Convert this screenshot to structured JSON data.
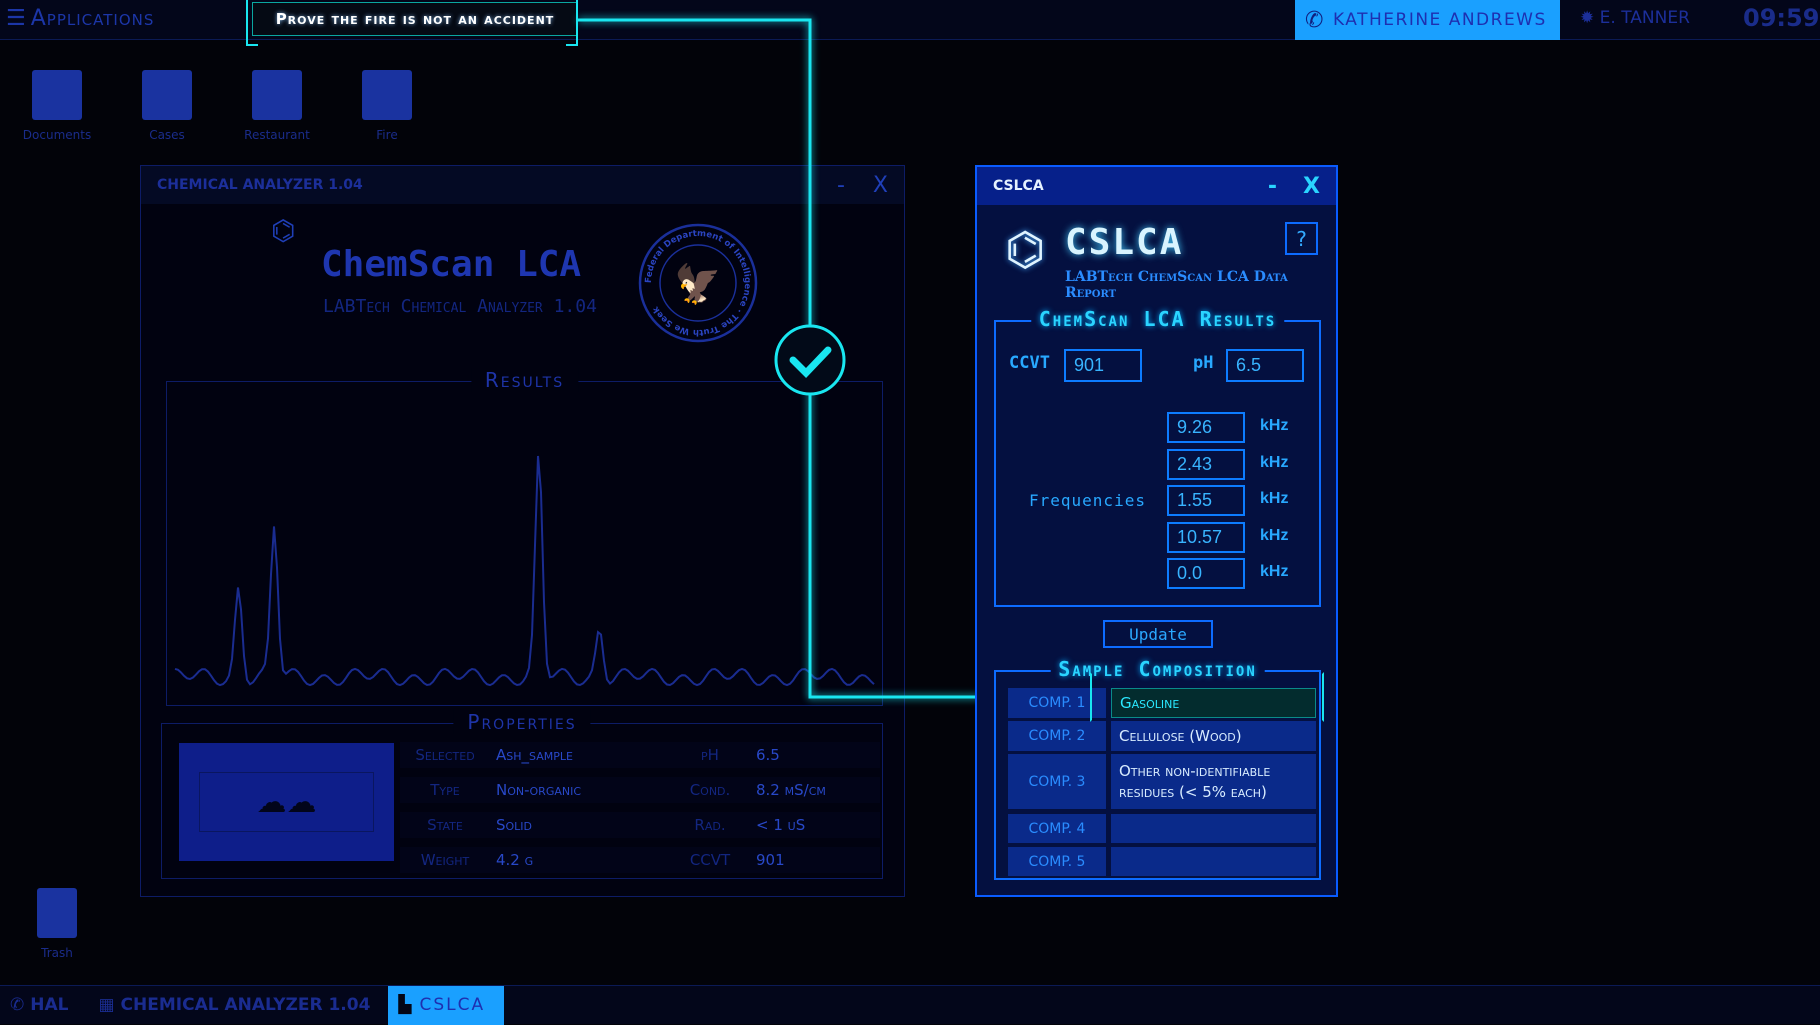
{
  "topbar": {
    "applications": "Applications",
    "objective": "Prove the fire is not an accident",
    "contact": "KATHERINE ANDREWS",
    "user": "E. TANNER",
    "clock": "09:59"
  },
  "desktop": {
    "icons": [
      {
        "label": "Documents"
      },
      {
        "label": "Cases"
      },
      {
        "label": "Restaurant"
      },
      {
        "label": "Fire"
      }
    ],
    "trash": "Trash"
  },
  "analyzer": {
    "title": "CHEMICAL ANALYZER 1.04",
    "minimize": "-",
    "close": "X",
    "logo": "ChemScan LCA",
    "subtitle": "LABTech Chemical Analyzer 1.04",
    "seal_text": "Federal Department of Intelligence · The Truth We Seek",
    "results_title": "Results",
    "properties_title": "Properties",
    "properties": [
      {
        "label": "Selected",
        "value": "Ash_sample",
        "label2": "pH",
        "value2": "6.5"
      },
      {
        "label": "Type",
        "value": "Non-organic",
        "label2": "Cond.",
        "value2": "8.2 mS/cm"
      },
      {
        "label": "State",
        "value": "Solid",
        "label2": "Rad.",
        "value2": "< 1 uS"
      },
      {
        "label": "Weight",
        "value": "4.2 g",
        "label2": "CCVT",
        "value2": "901"
      }
    ]
  },
  "cslca": {
    "title": "CSLCA",
    "minimize": "-",
    "close": "X",
    "app_name": "CSLCA",
    "subtitle": "LABTech ChemScan LCA Data Report",
    "help": "?",
    "results_title": "ChemScan LCA Results",
    "ccvt_label": "CCVT",
    "ccvt": "901",
    "ph_label": "pH",
    "ph": "6.5",
    "frequencies_label": "Frequencies",
    "frequencies": [
      {
        "value": "9.26",
        "unit": "kHz"
      },
      {
        "value": "2.43",
        "unit": "kHz"
      },
      {
        "value": "1.55",
        "unit": "kHz"
      },
      {
        "value": "10.57",
        "unit": "kHz"
      },
      {
        "value": "0.0",
        "unit": "kHz"
      }
    ],
    "update": "Update",
    "composition_title": "Sample Composition",
    "composition": [
      {
        "label": "COMP. 1",
        "value": "Gasoline",
        "selected": true
      },
      {
        "label": "COMP. 2",
        "value": "Cellulose (Wood)"
      },
      {
        "label": "COMP. 3",
        "value": "Other non-identifiable residues (< 5% each)"
      },
      {
        "label": "COMP. 4",
        "value": ""
      },
      {
        "label": "COMP. 5",
        "value": ""
      }
    ]
  },
  "taskbar": {
    "items": [
      {
        "label": "HAL"
      },
      {
        "label": "CHEMICAL ANALYZER 1.04"
      },
      {
        "label": "CSLCA",
        "active": true
      }
    ]
  },
  "colors": {
    "accent": "#19e6f0",
    "active": "#1aa0ff",
    "window_border": "#0a5cff"
  }
}
